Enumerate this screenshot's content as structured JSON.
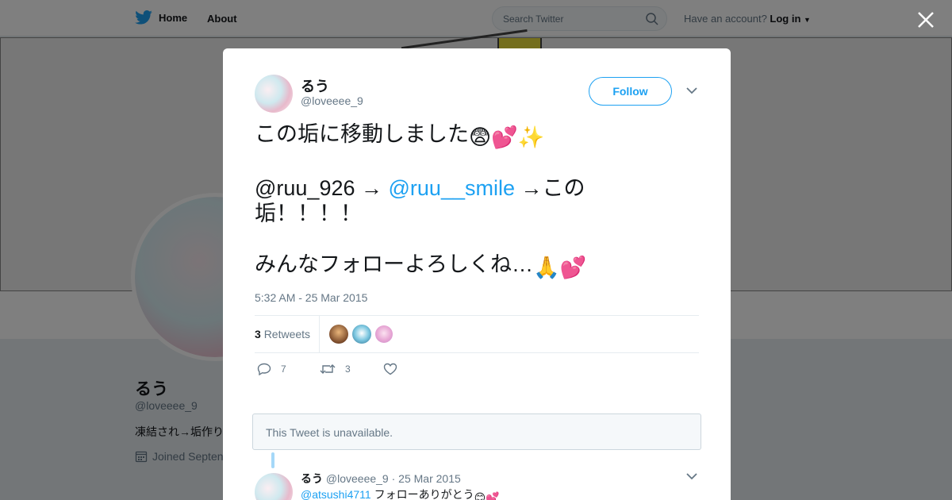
{
  "topbar": {
    "home_label": "Home",
    "about_label": "About",
    "search_placeholder": "Search Twitter",
    "account_prompt": "Have an account?",
    "login_label": "Log in"
  },
  "profile": {
    "name": "るう",
    "handle": "@loveeee_9",
    "bio": "凍結され→垢作り",
    "joined": "Joined Septen"
  },
  "modal": {
    "author": {
      "name": "るう",
      "handle": "@loveeee_9"
    },
    "follow_label": "Follow",
    "tweet": {
      "line1": "この垢に移動しました",
      "mention1": "@ruu_926",
      "arrow1": " → ",
      "mention2": "@ruu__smile",
      "line2_rest": " →この",
      "line3": "垢！！！！",
      "line4": "みんなフォローよろしくね…"
    },
    "timestamp": "5:32 AM - 25 Mar 2015",
    "retweets": {
      "count": "3",
      "label": "Retweets"
    },
    "actions": {
      "replies": "7",
      "retweets": "3"
    },
    "unavailable_text": "This Tweet is unavailable.",
    "reply": {
      "name": "るう",
      "handle": "@loveeee_9",
      "separator": "·",
      "date": "25 Mar 2015",
      "mention": "@atsushi4711",
      "text": " フォローありがとう"
    }
  },
  "colors": {
    "accent": "#1da1f2",
    "muted": "#657786",
    "text": "#14171a"
  }
}
